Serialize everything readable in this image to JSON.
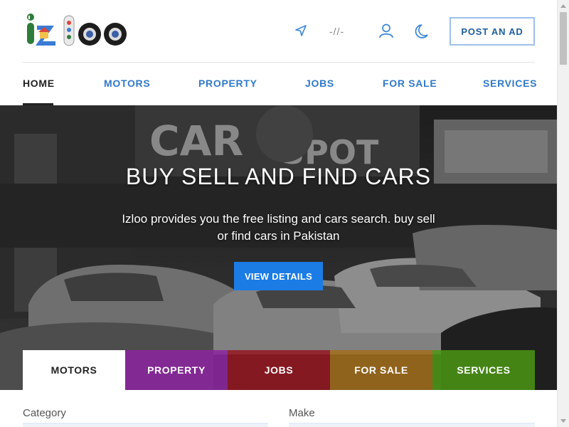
{
  "header": {
    "logo_text": "izloo",
    "date_text": "-//-",
    "post_ad_label": "POST AN AD",
    "icons": [
      "location-arrow-icon",
      "user-icon",
      "moon-icon"
    ]
  },
  "nav": {
    "items": [
      {
        "label": "HOME",
        "active": true
      },
      {
        "label": "MOTORS"
      },
      {
        "label": "PROPERTY"
      },
      {
        "label": "JOBS"
      },
      {
        "label": "FOR SALE"
      },
      {
        "label": "SERVICES"
      }
    ]
  },
  "hero": {
    "title": "BUY SELL AND FIND CARS",
    "subtitle": "Izloo provides you the free listing and cars search. buy sell or find cars in Pakistan",
    "button_label": "VIEW DETAILS",
    "sign_text": "THE CAR SPOT"
  },
  "tabs": [
    {
      "label": "MOTORS",
      "active": true
    },
    {
      "label": "PROPERTY"
    },
    {
      "label": "JOBS"
    },
    {
      "label": "FOR SALE"
    },
    {
      "label": "SERVICES"
    }
  ],
  "form": {
    "category_label": "Category",
    "make_label": "Make"
  },
  "colors": {
    "accent": "#1b7ce6",
    "nav_link": "#3079c9",
    "property_tab": "#8c23a0",
    "jobs_tab": "#96141e",
    "forsale_tab": "#a56e19",
    "services_tab": "#4b9614"
  }
}
